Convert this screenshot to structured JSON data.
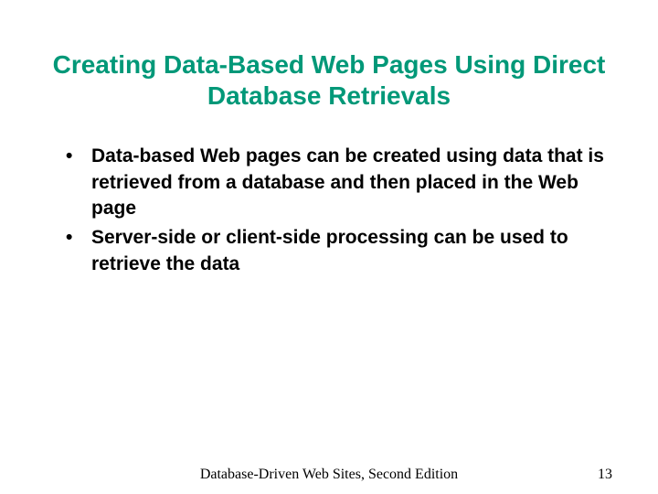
{
  "title": "Creating Data-Based Web Pages Using Direct Database Retrievals",
  "bullets": [
    "Data-based Web pages can be created using data that is retrieved from a database and then placed in the Web page",
    "Server-side or client-side processing can be used to retrieve the data"
  ],
  "footer": "Database-Driven Web Sites, Second Edition",
  "page": "13"
}
